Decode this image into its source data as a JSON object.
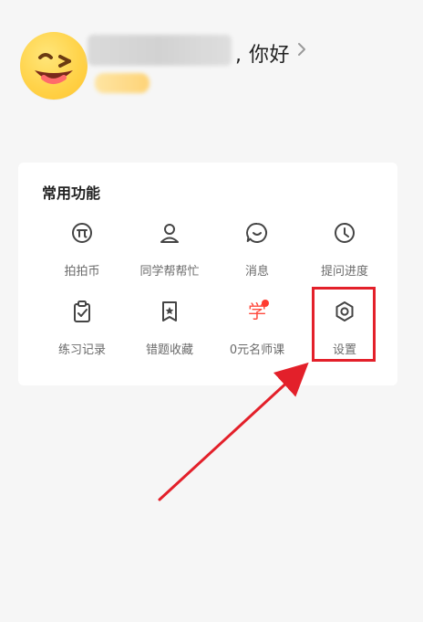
{
  "header": {
    "greeting": ", 你好"
  },
  "card": {
    "title": "常用功能",
    "items": [
      {
        "label": "拍拍币",
        "icon": "pi-coin-icon"
      },
      {
        "label": "同学帮帮忙",
        "icon": "person-icon"
      },
      {
        "label": "消息",
        "icon": "message-smile-icon"
      },
      {
        "label": "提问进度",
        "icon": "clock-icon"
      },
      {
        "label": "练习记录",
        "icon": "clipboard-check-icon"
      },
      {
        "label": "错题收藏",
        "icon": "bookmark-star-icon"
      },
      {
        "label": "0元名师课",
        "icon": "learn-char-icon"
      },
      {
        "label": "设置",
        "icon": "settings-hexagon-icon"
      }
    ],
    "notification_dot_color": "#ff3b30"
  },
  "annotation": {
    "highlight_color": "#e3202a"
  }
}
